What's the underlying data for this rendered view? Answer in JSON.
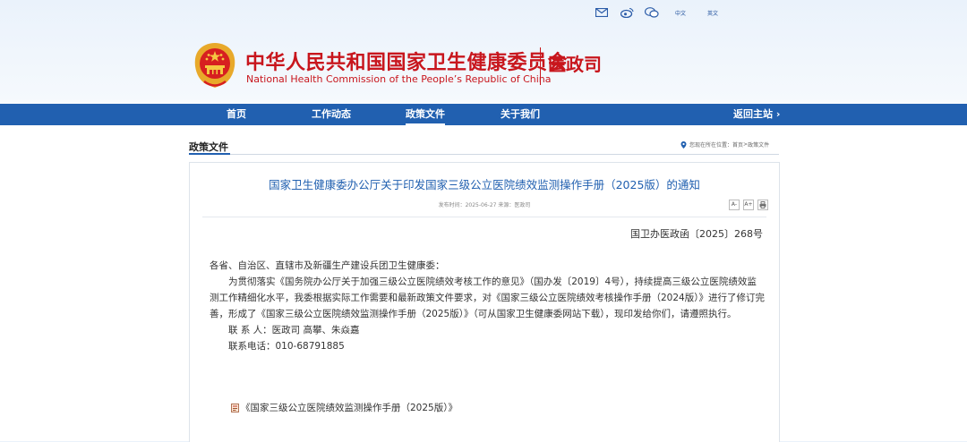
{
  "top_links": {
    "lang_cn": "中文",
    "lang_en": "英文",
    "icons": [
      "mail-icon",
      "weibo-icon",
      "wechat-icon"
    ]
  },
  "header": {
    "title_cn": "中华人民共和国国家卫生健康委员会",
    "title_en": "National Health Commission of the People’s Republic of China",
    "department": "医政司"
  },
  "nav": {
    "items": [
      "首页",
      "工作动态",
      "政策文件",
      "关于我们"
    ],
    "active": "政策文件",
    "return": "返回主站 ›"
  },
  "section": {
    "title": "政策文件",
    "crumb_prefix": "您现在所在位置：",
    "crumb_home": "首页",
    "crumb_sep": ">",
    "crumb_current": "政策文件"
  },
  "article": {
    "title": "国家卫生健康委办公厅关于印发国家三级公立医院绩效监测操作手册（2025版）的通知",
    "meta": "发布时间：2025-06-27    来源：医政司",
    "tools": [
      "A-",
      "A+",
      "print"
    ],
    "doc_number": "国卫办医政函〔2025〕268号",
    "salutation": "各省、自治区、直辖市及新疆生产建设兵团卫生健康委：",
    "paragraph": "为贯彻落实《国务院办公厅关于加强三级公立医院绩效考核工作的意见》（国办发〔2019〕4号），持续提高三级公立医院绩效监测工作精细化水平，我委根据实际工作需要和最新政策文件要求，对《国家三级公立医院绩效考核操作手册（2024版）》进行了修订完善，形成了《国家三级公立医院绩效监测操作手册（2025版）》（可从国家卫生健康委网站下载），现印发给你们，请遵照执行。",
    "contact": "联 系 人：医政司 高攀、朱焱嘉",
    "phone": "联系电话：010-68791885",
    "attachment": "《国家三级公立医院绩效监测操作手册（2025版）》"
  },
  "colors": {
    "brand_red": "#c8161d",
    "nav_blue": "#2160b0"
  }
}
